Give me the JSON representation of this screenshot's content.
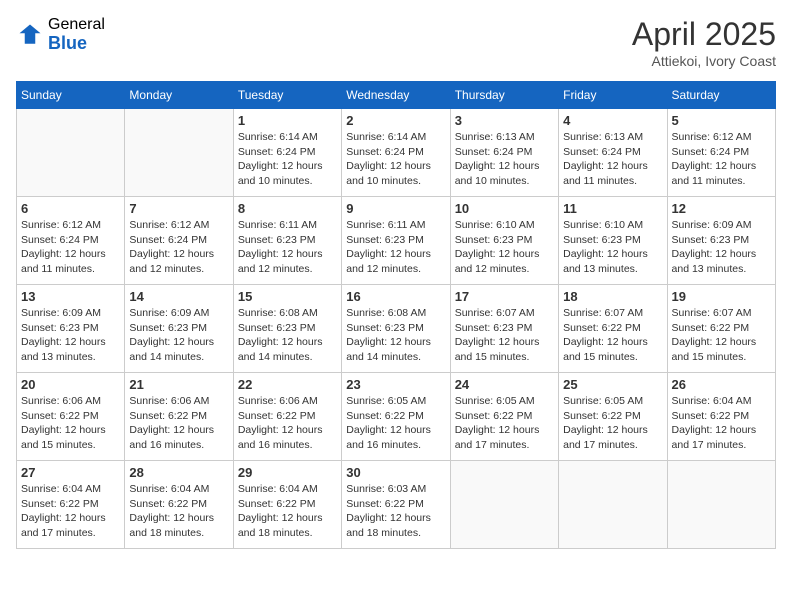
{
  "header": {
    "logo_general": "General",
    "logo_blue": "Blue",
    "title": "April 2025",
    "location": "Attiekoi, Ivory Coast"
  },
  "days_of_week": [
    "Sunday",
    "Monday",
    "Tuesday",
    "Wednesday",
    "Thursday",
    "Friday",
    "Saturday"
  ],
  "weeks": [
    [
      {
        "day": "",
        "info": ""
      },
      {
        "day": "",
        "info": ""
      },
      {
        "day": "1",
        "info": "Sunrise: 6:14 AM\nSunset: 6:24 PM\nDaylight: 12 hours and 10 minutes."
      },
      {
        "day": "2",
        "info": "Sunrise: 6:14 AM\nSunset: 6:24 PM\nDaylight: 12 hours and 10 minutes."
      },
      {
        "day": "3",
        "info": "Sunrise: 6:13 AM\nSunset: 6:24 PM\nDaylight: 12 hours and 10 minutes."
      },
      {
        "day": "4",
        "info": "Sunrise: 6:13 AM\nSunset: 6:24 PM\nDaylight: 12 hours and 11 minutes."
      },
      {
        "day": "5",
        "info": "Sunrise: 6:12 AM\nSunset: 6:24 PM\nDaylight: 12 hours and 11 minutes."
      }
    ],
    [
      {
        "day": "6",
        "info": "Sunrise: 6:12 AM\nSunset: 6:24 PM\nDaylight: 12 hours and 11 minutes."
      },
      {
        "day": "7",
        "info": "Sunrise: 6:12 AM\nSunset: 6:24 PM\nDaylight: 12 hours and 12 minutes."
      },
      {
        "day": "8",
        "info": "Sunrise: 6:11 AM\nSunset: 6:23 PM\nDaylight: 12 hours and 12 minutes."
      },
      {
        "day": "9",
        "info": "Sunrise: 6:11 AM\nSunset: 6:23 PM\nDaylight: 12 hours and 12 minutes."
      },
      {
        "day": "10",
        "info": "Sunrise: 6:10 AM\nSunset: 6:23 PM\nDaylight: 12 hours and 12 minutes."
      },
      {
        "day": "11",
        "info": "Sunrise: 6:10 AM\nSunset: 6:23 PM\nDaylight: 12 hours and 13 minutes."
      },
      {
        "day": "12",
        "info": "Sunrise: 6:09 AM\nSunset: 6:23 PM\nDaylight: 12 hours and 13 minutes."
      }
    ],
    [
      {
        "day": "13",
        "info": "Sunrise: 6:09 AM\nSunset: 6:23 PM\nDaylight: 12 hours and 13 minutes."
      },
      {
        "day": "14",
        "info": "Sunrise: 6:09 AM\nSunset: 6:23 PM\nDaylight: 12 hours and 14 minutes."
      },
      {
        "day": "15",
        "info": "Sunrise: 6:08 AM\nSunset: 6:23 PM\nDaylight: 12 hours and 14 minutes."
      },
      {
        "day": "16",
        "info": "Sunrise: 6:08 AM\nSunset: 6:23 PM\nDaylight: 12 hours and 14 minutes."
      },
      {
        "day": "17",
        "info": "Sunrise: 6:07 AM\nSunset: 6:23 PM\nDaylight: 12 hours and 15 minutes."
      },
      {
        "day": "18",
        "info": "Sunrise: 6:07 AM\nSunset: 6:22 PM\nDaylight: 12 hours and 15 minutes."
      },
      {
        "day": "19",
        "info": "Sunrise: 6:07 AM\nSunset: 6:22 PM\nDaylight: 12 hours and 15 minutes."
      }
    ],
    [
      {
        "day": "20",
        "info": "Sunrise: 6:06 AM\nSunset: 6:22 PM\nDaylight: 12 hours and 15 minutes."
      },
      {
        "day": "21",
        "info": "Sunrise: 6:06 AM\nSunset: 6:22 PM\nDaylight: 12 hours and 16 minutes."
      },
      {
        "day": "22",
        "info": "Sunrise: 6:06 AM\nSunset: 6:22 PM\nDaylight: 12 hours and 16 minutes."
      },
      {
        "day": "23",
        "info": "Sunrise: 6:05 AM\nSunset: 6:22 PM\nDaylight: 12 hours and 16 minutes."
      },
      {
        "day": "24",
        "info": "Sunrise: 6:05 AM\nSunset: 6:22 PM\nDaylight: 12 hours and 17 minutes."
      },
      {
        "day": "25",
        "info": "Sunrise: 6:05 AM\nSunset: 6:22 PM\nDaylight: 12 hours and 17 minutes."
      },
      {
        "day": "26",
        "info": "Sunrise: 6:04 AM\nSunset: 6:22 PM\nDaylight: 12 hours and 17 minutes."
      }
    ],
    [
      {
        "day": "27",
        "info": "Sunrise: 6:04 AM\nSunset: 6:22 PM\nDaylight: 12 hours and 17 minutes."
      },
      {
        "day": "28",
        "info": "Sunrise: 6:04 AM\nSunset: 6:22 PM\nDaylight: 12 hours and 18 minutes."
      },
      {
        "day": "29",
        "info": "Sunrise: 6:04 AM\nSunset: 6:22 PM\nDaylight: 12 hours and 18 minutes."
      },
      {
        "day": "30",
        "info": "Sunrise: 6:03 AM\nSunset: 6:22 PM\nDaylight: 12 hours and 18 minutes."
      },
      {
        "day": "",
        "info": ""
      },
      {
        "day": "",
        "info": ""
      },
      {
        "day": "",
        "info": ""
      }
    ]
  ]
}
